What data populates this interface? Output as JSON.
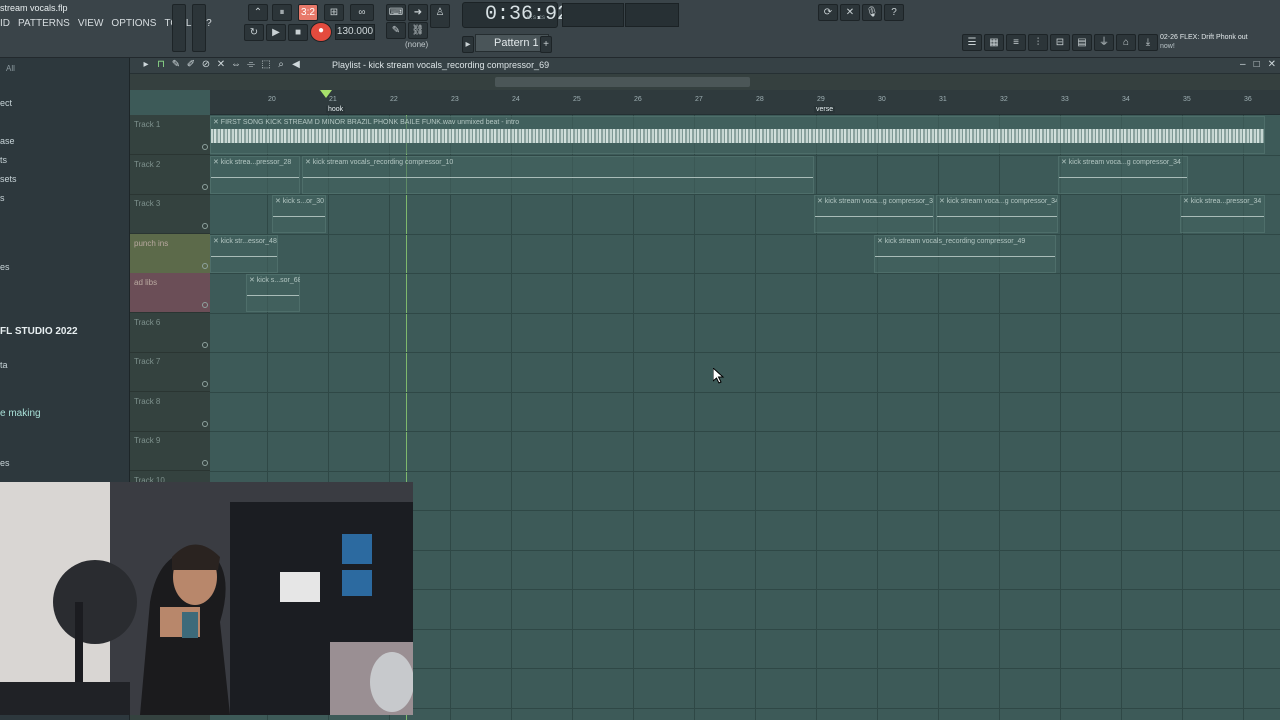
{
  "window": {
    "file_title": "stream vocals.flp"
  },
  "menu": [
    "ID",
    "PATTERNS",
    "VIEW",
    "OPTIONS",
    "TOOLS",
    "?"
  ],
  "transport": {
    "time": "0:36:92",
    "time_unit": "M:S:CS",
    "tempo": "130.000",
    "beat_indicator": "3:2"
  },
  "pattern": {
    "selected": "Pattern 1",
    "channel_filter": "(none)"
  },
  "hint": {
    "line1": "02-26  FLEX: Drift Phonk out",
    "line2": "now!"
  },
  "browser": {
    "filter": "All",
    "items": [
      "ect",
      "ase",
      "ts",
      "sets",
      "s",
      "es",
      "ta",
      "es"
    ],
    "fl_studio": "FL STUDIO 2022",
    "making": "e making"
  },
  "playlist": {
    "title": "Playlist - kick stream vocals_recording compressor_69",
    "bars": [
      "20",
      "21",
      "22",
      "23",
      "24",
      "25",
      "26",
      "27",
      "28",
      "29",
      "30",
      "31",
      "32",
      "33",
      "34",
      "35",
      "36"
    ],
    "markers": [
      {
        "label": "hook"
      },
      {
        "label": "verse"
      }
    ],
    "tracks": [
      "Track 1",
      "Track 2",
      "Track 3",
      "punch ins",
      "ad libs",
      "Track 6",
      "Track 7",
      "Track 8",
      "Track 9",
      "Track 10"
    ],
    "clips": [
      {
        "label": "FIRST SONG KICK STREAM D MINOR BRAZIL PHONK BAILE FUNK.wav unmixed beat - intro"
      },
      {
        "label": "kick strea...pressor_28"
      },
      {
        "label": "kick stream vocals_recording compressor_10"
      },
      {
        "label": "kick stream voca...g compressor_34"
      },
      {
        "label": "kick s...or_30"
      },
      {
        "label": "kick stream voca...g compressor_34"
      },
      {
        "label": "kick stream voca...g compressor_34"
      },
      {
        "label": "kick strea...pressor_34"
      },
      {
        "label": "kick str...essor_48"
      },
      {
        "label": "kick stream vocals_recording compressor_49"
      },
      {
        "label": "kick s...sor_68"
      }
    ]
  },
  "colors": {
    "grid_bg": "#3d5a58",
    "punch_ins": "#5c6a4a",
    "ad_libs": "#6b4e57",
    "playhead": "#a7e06b"
  }
}
